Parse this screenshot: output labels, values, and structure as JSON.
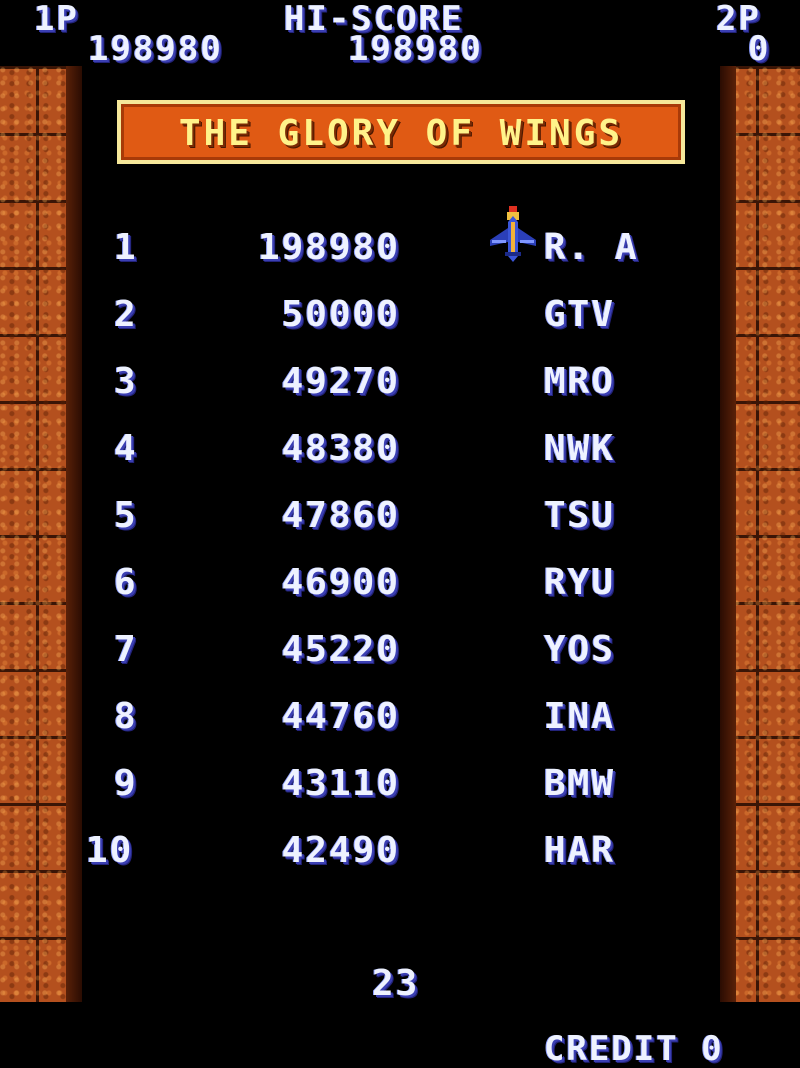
{
  "hud": {
    "p1_label": "1P",
    "p1_score": "198980",
    "hiscore_label": "HI-SCORE",
    "hiscore_value": "198980",
    "p2_label": "2P",
    "p2_score": "0"
  },
  "title": "THE GLORY OF WINGS",
  "rankings": [
    {
      "rank": "1",
      "score": "198980",
      "name": "R. A"
    },
    {
      "rank": "2",
      "score": "50000",
      "name": "GTV"
    },
    {
      "rank": "3",
      "score": "49270",
      "name": "MRO"
    },
    {
      "rank": "4",
      "score": "48380",
      "name": "NWK"
    },
    {
      "rank": "5",
      "score": "47860",
      "name": "TSU"
    },
    {
      "rank": "6",
      "score": "46900",
      "name": "RYU"
    },
    {
      "rank": "7",
      "score": "45220",
      "name": "YOS"
    },
    {
      "rank": "8",
      "score": "44760",
      "name": "INA"
    },
    {
      "rank": "9",
      "score": "43110",
      "name": "BMW"
    },
    {
      "rank": "10",
      "score": "42490",
      "name": "HAR"
    }
  ],
  "timer": "23",
  "credit": "CREDIT 0",
  "icons": {
    "ship": "player-ship-icon"
  },
  "colors": {
    "text": "#eef2ff",
    "text_shadow": "#3b3fb3",
    "banner_bg": "#e05a14",
    "banner_border": "#f6e89a",
    "banner_text": "#fff38a",
    "brick": "#b4501e"
  }
}
